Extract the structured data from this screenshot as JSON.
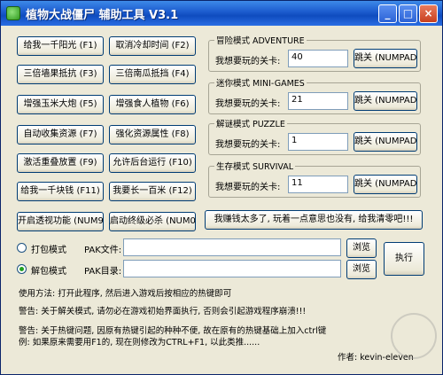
{
  "window": {
    "title": "植物大战僵尸  辅助工具  V3.1",
    "minimize_glyph": "_",
    "maximize_glyph": "□",
    "close_glyph": "×"
  },
  "buttons": {
    "sun1000": "给我一千阳光 (F1)",
    "no_cooldown": "取消冷却时间 (F2)",
    "wallnut_3x": "三倍墙果抵抗 (F3)",
    "pumpkin_3x": "三倍南瓜抵挡 (F4)",
    "corn_cannon": "增强玉米大炮 (F5)",
    "chomper": "增强食人植物 (F6)",
    "auto_collect": "自动收集资源 (F7)",
    "resource_boost": "强化资源属性 (F8)",
    "overlap": "激活重叠放置 (F9)",
    "background_run": "允许后台运行 (F10)",
    "coins1000": "给我一千块钱 (F11)",
    "grow100m": "我要长一百米 (F12)",
    "xray": "开启透视功能 (NUM9)",
    "ultimate": "启动终级必杀 (NUM0)",
    "rich": "我赚钱太多了, 玩着一点意思也没有, 给我清零吧!!!",
    "execute": "执行",
    "browse1": "浏览",
    "browse2": "浏览"
  },
  "modes": {
    "adventure": {
      "title": "冒险模式 ADVENTURE",
      "label": "我想要玩的关卡:",
      "value": "40",
      "button": "跳关 (NUMPAD1)"
    },
    "minigames": {
      "title": "迷你模式 MINI-GAMES",
      "label": "我想要玩的关卡:",
      "value": "21",
      "button": "跳关 (NUMPAD2)"
    },
    "puzzle": {
      "title": "解谜模式 PUZZLE",
      "label": "我想要玩的关卡:",
      "value": "1",
      "button": "跳关 (NUMPAD3)"
    },
    "survival": {
      "title": "生存模式 SURVIVAL",
      "label": "我想要玩的关卡:",
      "value": "11",
      "button": "跳关 (NUMPAD4)"
    }
  },
  "pack": {
    "pack_label": "打包模式",
    "pak_file_label": "PAK文件:",
    "unpack_label": "解包模式",
    "pak_dir_label": "PAK目录:"
  },
  "info": {
    "usage": "使用方法: 打开此程序, 然后进入游戏后按相应的热键即可",
    "warning1": "警告: 关于解关模式, 请勿必在游戏初始界面执行, 否则会引起游戏程序崩溃!!!",
    "warning2_line1": "警告: 关于热键问题, 因原有热键引起的种种不便, 故在原有的热键基础上加入ctrl键",
    "warning2_line2": "例: 如果原来需要用F1的, 现在则修改为CTRL+F1, 以此类推......",
    "author": "作者: kevin-eleven"
  }
}
